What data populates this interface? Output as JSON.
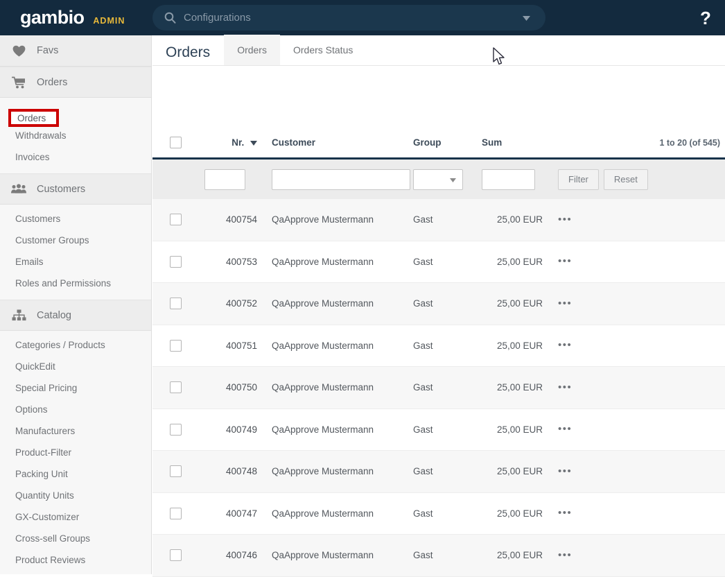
{
  "topbar": {
    "logo": "gambio",
    "admin_label": "ADMIN",
    "search_placeholder": "Configurations",
    "search_value": "",
    "search_icon": "search-icon",
    "caret_icon": "chevron-down-icon",
    "help_icon": "?",
    "bg_color": "#132a3e",
    "admin_color": "#e8b93a"
  },
  "sidebar": {
    "sections": [
      {
        "label": "Favs",
        "icon": "heart-icon",
        "items": []
      },
      {
        "label": "Orders",
        "icon": "cart-icon",
        "items": [
          {
            "label": "Orders",
            "active": true
          },
          {
            "label": "Withdrawals",
            "active": false
          },
          {
            "label": "Invoices",
            "active": false
          }
        ]
      },
      {
        "label": "Customers",
        "icon": "users-icon",
        "items": [
          {
            "label": "Customers",
            "active": false
          },
          {
            "label": "Customer Groups",
            "active": false
          },
          {
            "label": "Emails",
            "active": false
          },
          {
            "label": "Roles and Permissions",
            "active": false
          }
        ]
      },
      {
        "label": "Catalog",
        "icon": "sitemap-icon",
        "items": [
          {
            "label": "Categories / Products",
            "active": false
          },
          {
            "label": "QuickEdit",
            "active": false
          },
          {
            "label": "Special Pricing",
            "active": false
          },
          {
            "label": "Options",
            "active": false
          },
          {
            "label": "Manufacturers",
            "active": false
          },
          {
            "label": "Product-Filter",
            "active": false
          },
          {
            "label": "Packing Unit",
            "active": false
          },
          {
            "label": "Quantity Units",
            "active": false
          },
          {
            "label": "GX-Customizer",
            "active": false
          },
          {
            "label": "Cross-sell Groups",
            "active": false
          },
          {
            "label": "Product Reviews",
            "active": false
          }
        ]
      }
    ]
  },
  "annotation": {
    "label": "Orders",
    "color": "#cc0000"
  },
  "page": {
    "title": "Orders",
    "tabs": [
      {
        "label": "Orders",
        "active": true
      },
      {
        "label": "Orders Status",
        "active": false
      }
    ]
  },
  "table": {
    "headers": {
      "select_all": "",
      "nr": "Nr.",
      "sort_icon": "caret-down-icon",
      "customer": "Customer",
      "group": "Group",
      "sum": "Sum",
      "pagination": "1 to 20 (of 545)"
    },
    "filters": {
      "nr_value": "",
      "customer_value": "",
      "group_value": "",
      "sum_value": "",
      "filter_label": "Filter",
      "reset_label": "Reset"
    },
    "rows": [
      {
        "nr": "400754",
        "customer": "QaApprove Mustermann",
        "group": "Gast",
        "sum": "25,00 EUR",
        "actions": "•••"
      },
      {
        "nr": "400753",
        "customer": "QaApprove Mustermann",
        "group": "Gast",
        "sum": "25,00 EUR",
        "actions": "•••"
      },
      {
        "nr": "400752",
        "customer": "QaApprove Mustermann",
        "group": "Gast",
        "sum": "25,00 EUR",
        "actions": "•••"
      },
      {
        "nr": "400751",
        "customer": "QaApprove Mustermann",
        "group": "Gast",
        "sum": "25,00 EUR",
        "actions": "•••"
      },
      {
        "nr": "400750",
        "customer": "QaApprove Mustermann",
        "group": "Gast",
        "sum": "25,00 EUR",
        "actions": "•••"
      },
      {
        "nr": "400749",
        "customer": "QaApprove Mustermann",
        "group": "Gast",
        "sum": "25,00 EUR",
        "actions": "•••"
      },
      {
        "nr": "400748",
        "customer": "QaApprove Mustermann",
        "group": "Gast",
        "sum": "25,00 EUR",
        "actions": "•••"
      },
      {
        "nr": "400747",
        "customer": "QaApprove Mustermann",
        "group": "Gast",
        "sum": "25,00 EUR",
        "actions": "•••"
      },
      {
        "nr": "400746",
        "customer": "QaApprove Mustermann",
        "group": "Gast",
        "sum": "25,00 EUR",
        "actions": "•••"
      }
    ]
  }
}
